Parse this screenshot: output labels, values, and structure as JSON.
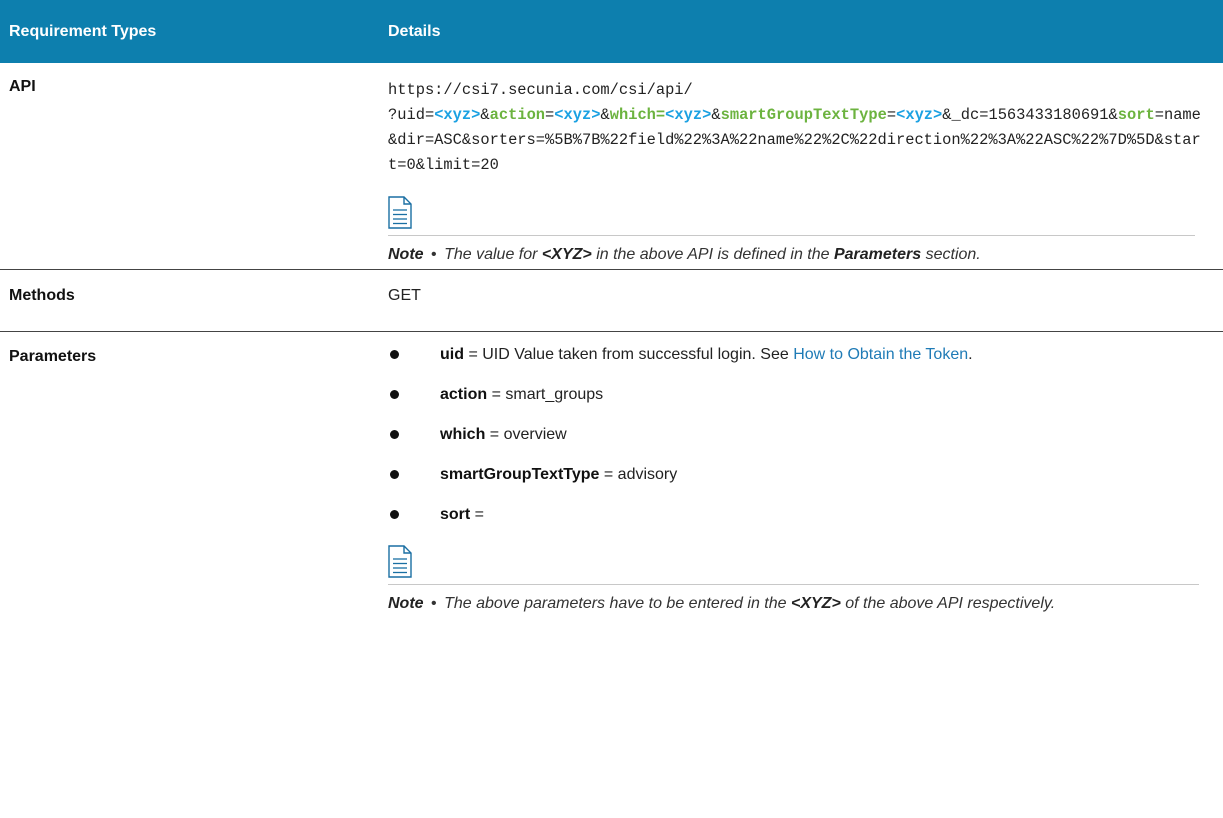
{
  "table": {
    "header": {
      "col1": "Requirement Types",
      "col2": "Details"
    },
    "api": {
      "label": "API",
      "url": {
        "line1": "https://csi7.secunia.com/csi/api/",
        "p_uid": "?uid=",
        "xyz": "<xyz>",
        "amp": "&",
        "action": "action",
        "eq": "=",
        "which": "which=",
        "smart": "smartGroupTextType",
        "dc": "&_dc=1563433180691&",
        "sort": "sort",
        "tail": "=name&dir=ASC&sorters=%5B%7B%22field%22%3A%22name%22%2C%22direction%22%3A%22ASC%22%7D%5D&start=0&limit=20"
      },
      "note": {
        "label": "Note",
        "bullet": "•",
        "text_a": "The value for",
        "xyz": "<XYZ>",
        "text_b": "in the above API is defined in the",
        "params": "Parameters",
        "text_c": "section."
      }
    },
    "methods": {
      "label": "Methods",
      "value": "GET"
    },
    "parameters": {
      "label": "Parameters",
      "items": [
        {
          "key": "uid",
          "value": " = UID Value taken from successful login. See ",
          "link": "How to Obtain the Token",
          "after": "."
        },
        {
          "key": "action",
          "value": " = smart_groups"
        },
        {
          "key": "which",
          "value": " = overview"
        },
        {
          "key": "smartGroupTextType",
          "value": " = advisory"
        },
        {
          "key": "sort",
          "value": " ="
        }
      ],
      "note": {
        "label": "Note",
        "bullet": "•",
        "text_a": "The above parameters have to be entered in the",
        "xyz": "<XYZ>",
        "text_b": "of the above API respectively."
      }
    }
  },
  "icons": {
    "note": "note-document-icon"
  },
  "colors": {
    "header_bg": "#0d7fae",
    "placeholder_blue": "#1ba1e2",
    "param_green": "#6cb33f",
    "link": "#1f7bb6"
  }
}
